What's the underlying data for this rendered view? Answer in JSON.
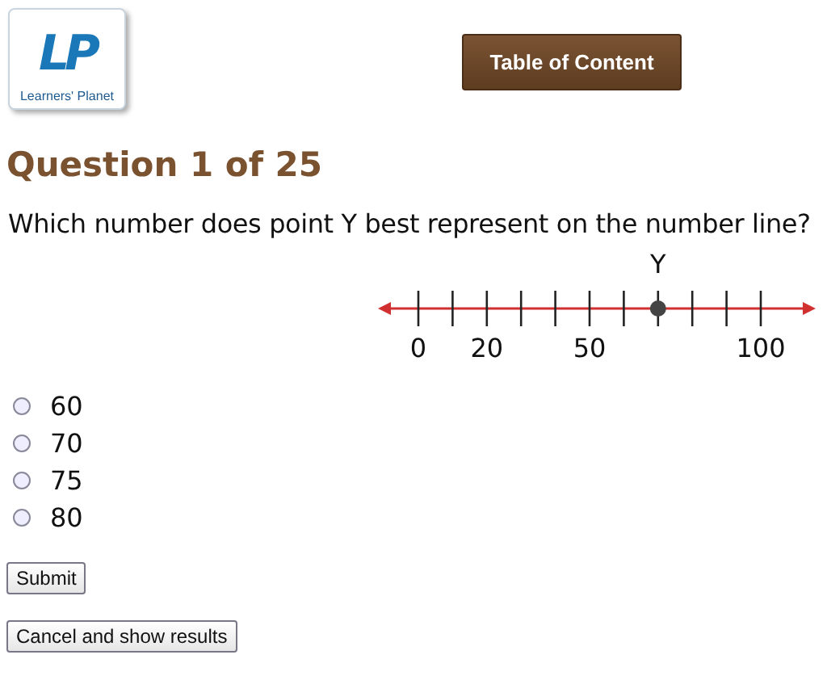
{
  "logo": {
    "mark": "LP",
    "caption": "Learners' Planet"
  },
  "toc_button": "Table of Content",
  "heading": "Question 1 of 25",
  "question": "Which number does point Y best represent on the number line?",
  "number_line": {
    "ticks": [
      {
        "kind": "labeled",
        "label": "0"
      },
      {
        "kind": "plain"
      },
      {
        "kind": "labeled",
        "label": "20"
      },
      {
        "kind": "plain"
      },
      {
        "kind": "plain"
      },
      {
        "kind": "labeled",
        "label": "50"
      },
      {
        "kind": "plain"
      },
      {
        "kind": "point",
        "point_label": "Y"
      },
      {
        "kind": "plain"
      },
      {
        "kind": "plain"
      },
      {
        "kind": "labeled",
        "label": "100"
      }
    ]
  },
  "options": [
    {
      "label": "60",
      "selected": false
    },
    {
      "label": "70",
      "selected": false
    },
    {
      "label": "75",
      "selected": false
    },
    {
      "label": "80",
      "selected": false
    }
  ],
  "buttons": [
    "Submit",
    "Cancel and show results"
  ]
}
